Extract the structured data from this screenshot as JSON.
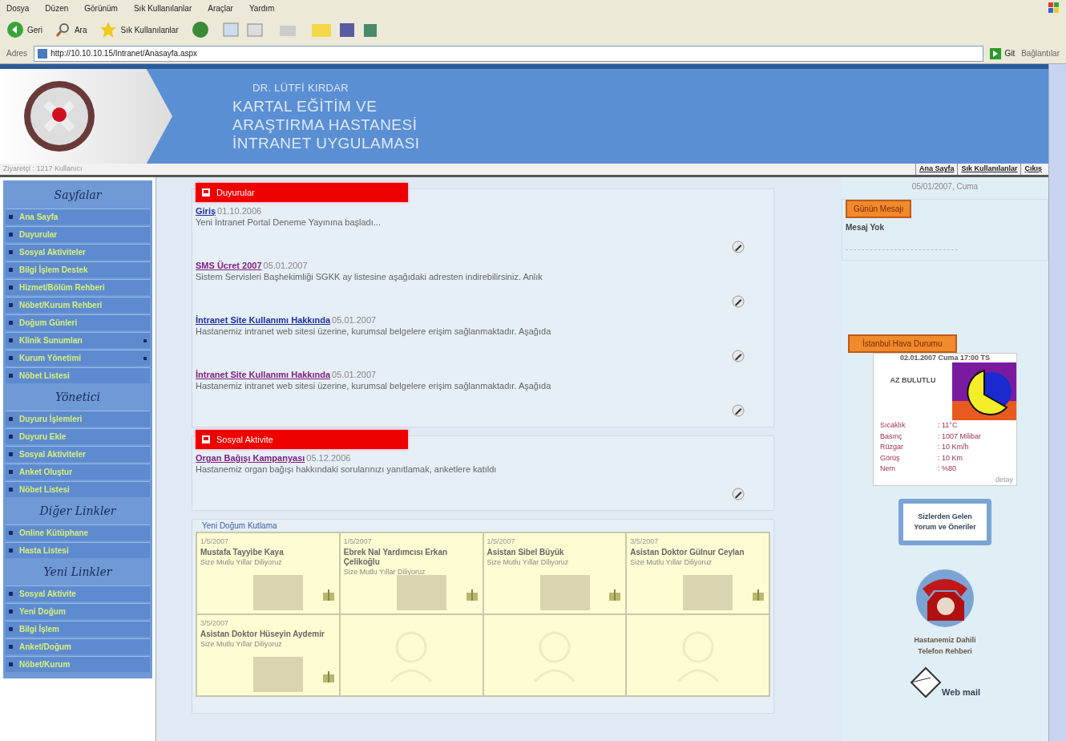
{
  "browser": {
    "menu": [
      "Dosya",
      "Düzen",
      "Görünüm",
      "Sık Kullanılanlar",
      "Araçlar",
      "Yardım"
    ],
    "toolbar": [
      {
        "label": "Geri",
        "kind": "back"
      },
      {
        "label": "Ara",
        "kind": "search"
      },
      {
        "label": "Sık Kullanılanlar",
        "kind": "star"
      }
    ],
    "address_label": "Adres",
    "url": "http://10.10.10.15/Intranet/Anasayfa.aspx",
    "go_label": "Git",
    "links_label": "Bağlantılar"
  },
  "header": {
    "title_lines": [
      "DR. LÜTFİ KIRDAR",
      "KARTAL EĞİTİM VE",
      "ARAŞTIRMA HASTANESİ",
      "İNTRANET UYGULAMASI"
    ],
    "visitor": "Ziyaretçi : 1217 Kullanıcı",
    "nav_links": [
      "Ana Sayfa",
      "Sık Kullanılanlar",
      "Çıkış"
    ]
  },
  "sidebar": {
    "sections": [
      {
        "title": "Sayfalar",
        "items": [
          {
            "label": "Ana Sayfa",
            "submenu": false
          },
          {
            "label": "Duyurular",
            "submenu": false
          },
          {
            "label": "Sosyal Aktiviteler",
            "submenu": false
          },
          {
            "label": "Bilgi İşlem Destek",
            "submenu": false
          },
          {
            "label": "Hizmet/Bölüm Rehberi",
            "submenu": false
          },
          {
            "label": "Nöbet/Kurum Rehberi",
            "submenu": false
          },
          {
            "label": "Doğum Günleri",
            "submenu": false
          },
          {
            "label": "Klinik Sunumları",
            "submenu": true
          },
          {
            "label": "Kurum Yönetimi",
            "submenu": true
          },
          {
            "label": "Nöbet Listesi",
            "submenu": false
          }
        ]
      },
      {
        "title": "Yönetici",
        "items": [
          {
            "label": "Duyuru İşlemleri",
            "submenu": false
          },
          {
            "label": "Duyuru Ekle",
            "submenu": false
          },
          {
            "label": "Sosyal Aktiviteler",
            "submenu": false
          },
          {
            "label": "Anket Oluştur",
            "submenu": false
          },
          {
            "label": "Nöbet Listesi",
            "submenu": false
          }
        ]
      },
      {
        "title": "Diğer Linkler",
        "items": [
          {
            "label": "Online Kütüphane",
            "submenu": false
          },
          {
            "label": "Hasta Listesi",
            "submenu": false
          }
        ]
      },
      {
        "title": "Yeni Linkler",
        "items": [
          {
            "label": "Sosyal Aktivite",
            "submenu": false
          },
          {
            "label": "Yeni Doğum",
            "submenu": false
          },
          {
            "label": "Bilgi İşlem",
            "submenu": false
          },
          {
            "label": "Anket/Doğum",
            "submenu": false
          },
          {
            "label": "Nöbet/Kurum",
            "submenu": false
          }
        ]
      }
    ]
  },
  "announcements": {
    "title": "Duyurular",
    "items": [
      {
        "title": "Giriş",
        "date": "01.10.2006",
        "text": "Yeni İntranet Portal Deneme Yayınına başladı...",
        "visited": false
      },
      {
        "title": "SMS Ücret 2007",
        "date": "05.01.2007",
        "text": "Sistem Servisleri Başhekimliği SGKK ay listesine aşağıdaki adresten indirebilirsiniz. Anlık",
        "visited": true
      },
      {
        "title": "İntranet Site Kullanımı Hakkında",
        "date": "05.01.2007",
        "text": "Hastanemiz intranet web sitesi üzerine, kurumsal belgelere erişim sağlanmaktadır. Aşağıda",
        "visited": false
      },
      {
        "title": "İntranet Site Kullanımı Hakkında",
        "date": "05.01.2007",
        "text": "Hastanemiz intranet web sitesi üzerine, kurumsal belgelere erişim sağlanmaktadır. Aşağıda",
        "visited": true
      }
    ]
  },
  "social": {
    "title": "Sosyal Aktivite",
    "items": [
      {
        "title": "Organ Bağışı Kampanyası",
        "date": "05.12.2006",
        "text": "Hastanemiz organ bağışı hakkındaki sorularınızı yanıtlamak, anketlere katıldı",
        "visited": true
      }
    ]
  },
  "birthdays": {
    "title": "Yeni Doğum Kutlama",
    "cells": [
      {
        "kind": "person",
        "date": "1/5/2007",
        "name": "Mustafa Tayyibe Kaya",
        "message": "Size Mutlu Yıllar Diliyoruz"
      },
      {
        "kind": "person",
        "date": "1/5/2007",
        "name": "Ebrek Nal Yardımcısı Erkan Çelikoğlu",
        "message": "Size Mutlu Yıllar Diliyoruz"
      },
      {
        "kind": "person",
        "date": "1/5/2007",
        "name": "Asistan Sibel Büyük",
        "message": "Size Mutlu Yıllar Diliyoruz"
      },
      {
        "kind": "person",
        "date": "3/5/2007",
        "name": "Asistan Doktor Gülnur Ceylan",
        "message": "Size Mutlu Yıllar Diliyoruz"
      },
      {
        "kind": "person",
        "date": "3/5/2007",
        "name": "Asistan Doktor Hüseyin Aydemir",
        "message": "Size Mutlu Yıllar Diliyoruz"
      },
      {
        "kind": "empty"
      },
      {
        "kind": "empty"
      },
      {
        "kind": "empty"
      }
    ]
  },
  "right": {
    "date": "05/01/2007, Cuma",
    "message_box": {
      "title": "Günün Mesajı",
      "text": "Mesaj Yok"
    },
    "weather": {
      "title": "İstanbul Hava Durumu",
      "heading": "02.01.2007 Cuma 17:00 TS",
      "condition": "AZ BULUTLU",
      "rows": [
        {
          "label": "Sıcaklık",
          "value": ": 11°C"
        },
        {
          "label": "Basınç",
          "value": ": 1007 Milibar"
        },
        {
          "label": "Rüzgar",
          "value": ": 10 Km/h"
        },
        {
          "label": "Görüş",
          "value": ": 10 Km"
        },
        {
          "label": "Nem",
          "value": ": %80"
        }
      ],
      "link": "detay"
    },
    "suggestion": "Sizlerden Gelen Yorum ve Öneriler",
    "phone_caption": "Hastanemiz Dahili Telefon Rehberi",
    "mail_label": "Web mail"
  }
}
